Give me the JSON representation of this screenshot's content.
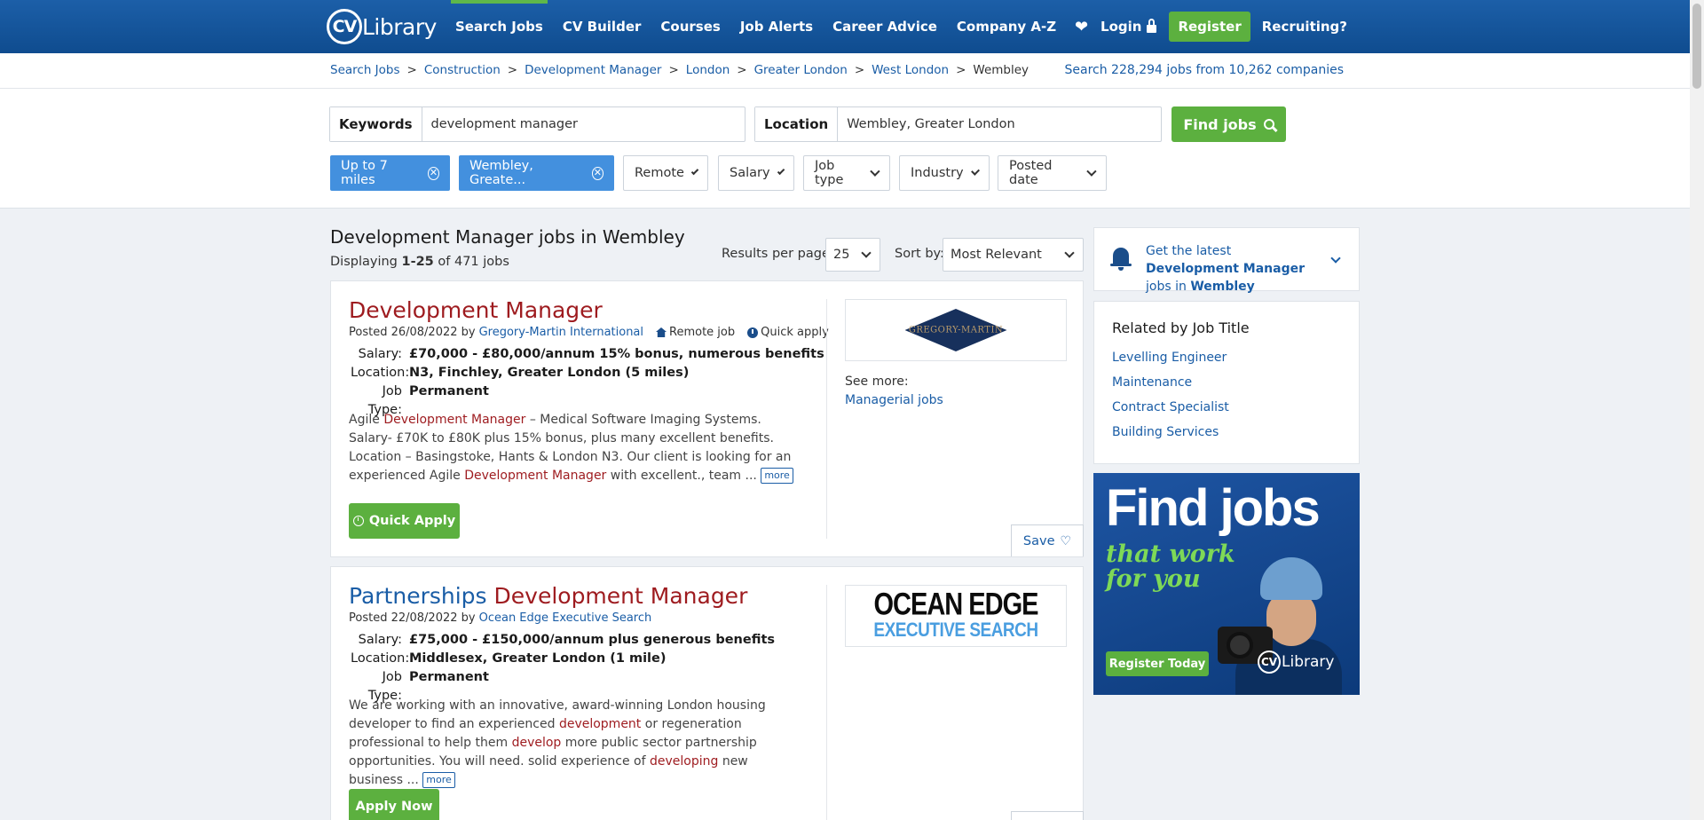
{
  "header": {
    "logo_cv": "CV",
    "logo_text": "Library",
    "nav": [
      "Search Jobs",
      "CV Builder",
      "Courses",
      "Job Alerts",
      "Career Advice",
      "Company A-Z"
    ],
    "login": "Login",
    "register": "Register",
    "recruiting": "Recruiting?"
  },
  "breadcrumb": {
    "items": [
      "Search Jobs",
      "Construction",
      "Development Manager",
      "London",
      "Greater London",
      "West London"
    ],
    "current": "Wembley",
    "stats_prefix": "Search ",
    "stats_jobs": "228,294 jobs",
    "stats_mid": " from ",
    "stats_companies": "10,262 companies"
  },
  "search": {
    "keywords_label": "Keywords",
    "keywords_value": "development manager",
    "location_label": "Location",
    "location_value": "Wembley, Greater London",
    "find_button": "Find jobs"
  },
  "filters": {
    "chips": [
      "Up to 7 miles",
      "Wembley, Greate..."
    ],
    "dropdowns": [
      "Remote",
      "Salary",
      "Job type",
      "Industry",
      "Posted date"
    ]
  },
  "results": {
    "title": "Development Manager jobs in Wembley",
    "displaying": "Displaying ",
    "range": "1-25",
    "of_total": " of 471 jobs",
    "rpp_label": "Results per page:",
    "rpp_value": "25",
    "sort_label": "Sort by:",
    "sort_value": "Most Relevant"
  },
  "jobs": [
    {
      "title": "Development Manager",
      "posted": "Posted 26/08/2022 by",
      "company": "Gregory-Martin International",
      "remote": "Remote job",
      "quick": "Quick apply",
      "salary_label": "Salary:",
      "salary": "£70,000 - £80,000/annum 15% bonus, numerous benefits",
      "location_label": "Location:",
      "location": "N3, Finchley, Greater London (5 miles)",
      "type_label": "Job Type:",
      "type": "Permanent",
      "desc_1": "Agile ",
      "desc_hl_1": "Development Manager",
      "desc_2": " – Medical Software Imaging Systems. Salary- £70K to £80K plus 15% bonus, plus many excellent benefits. Location – Basingstoke, Hants & London N3. Our client is looking for an experienced Agile ",
      "desc_hl_2": "Development Manager",
      "desc_3": " with excellent., team ... ",
      "more": "more",
      "button": "Quick Apply",
      "logo_text": "GREGORY-MARTIN",
      "see_more": "See more:",
      "see_more_link": "Managerial jobs",
      "save": "Save"
    },
    {
      "title_plain": "Partnerships ",
      "title": "Development Manager",
      "posted": "Posted 22/08/2022 by",
      "company": "Ocean Edge Executive Search",
      "salary_label": "Salary:",
      "salary": "£75,000 - £150,000/annum plus generous benefits",
      "location_label": "Location:",
      "location": "Middlesex, Greater London (1 mile)",
      "type_label": "Job Type:",
      "type": "Permanent",
      "desc_1": "We are working with an innovative, award-winning London housing developer to find an experienced ",
      "desc_hl_1": "development",
      "desc_2": " or regeneration professional to help them ",
      "desc_hl_2": "develop",
      "desc_3": " more public sector partnership opportunities. You will need. solid experience of ",
      "desc_hl_3": "developing",
      "desc_4": " new business ... ",
      "more": "more",
      "button": "Apply Now",
      "logo_line1": "OCEAN EDGE",
      "logo_line2": "EXECUTIVE SEARCH"
    }
  ],
  "sidebar": {
    "alert_1": "Get the latest ",
    "alert_bold_1": "Development Manager",
    "alert_2": " jobs in ",
    "alert_bold_2": "Wembley",
    "related_title": "Related by Job Title",
    "related": [
      "Levelling Engineer",
      "Maintenance",
      "Contract Specialist",
      "Building Services"
    ],
    "ad_title": "Find jobs",
    "ad_sub_1": "that work",
    "ad_sub_2": "for you",
    "ad_button": "Register Today",
    "ad_logo_cv": "CV",
    "ad_logo_text": "Library"
  },
  "colors": {
    "header": "#0f4c8f",
    "green": "#5cb03f",
    "chip_blue": "#4390de",
    "link": "#1a5da6",
    "highlight": "#9e1b1f"
  }
}
